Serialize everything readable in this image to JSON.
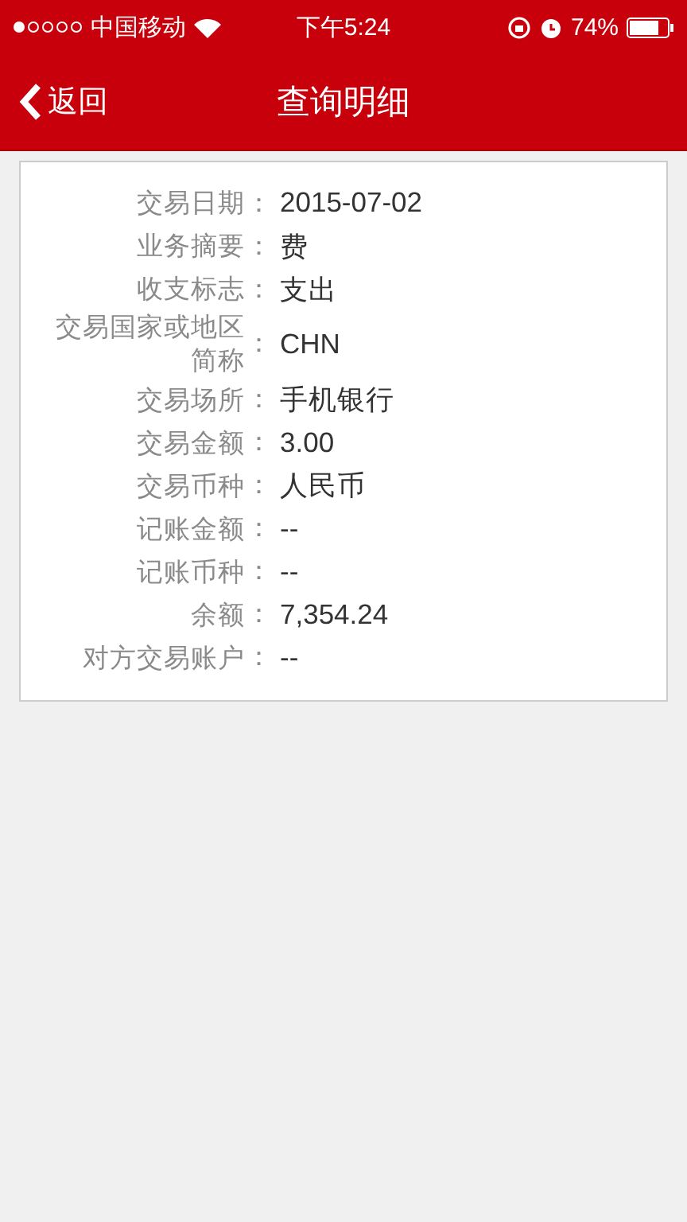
{
  "status_bar": {
    "carrier": "中国移动",
    "time": "下午5:24",
    "battery": "74%"
  },
  "nav": {
    "back": "返回",
    "title": "查询明细"
  },
  "details": [
    {
      "label": "交易日期",
      "separator": "：",
      "value": "2015-07-02"
    },
    {
      "label": "业务摘要",
      "separator": "：",
      "value": "费"
    },
    {
      "label": "收支标志",
      "separator": "：",
      "value": "支出"
    },
    {
      "label": "交易国家或地区简称",
      "separator": "：",
      "value": "CHN"
    },
    {
      "label": "交易场所",
      "separator": "：",
      "value": "手机银行"
    },
    {
      "label": "交易金额",
      "separator": "：",
      "value": "3.00"
    },
    {
      "label": "交易币种",
      "separator": "：",
      "value": "人民币"
    },
    {
      "label": "记账金额",
      "separator": "：",
      "value": "--"
    },
    {
      "label": "记账币种",
      "separator": "：",
      "value": "--"
    },
    {
      "label": "余额",
      "separator": "：",
      "value": "7,354.24"
    },
    {
      "label": "对方交易账户",
      "separator": "：",
      "value": "--"
    }
  ]
}
